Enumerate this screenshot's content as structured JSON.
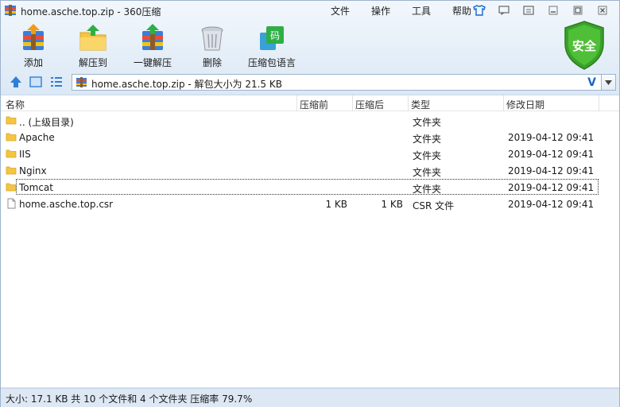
{
  "window": {
    "title": "home.asche.top.zip - 360压缩"
  },
  "menu": [
    "文件",
    "操作",
    "工具",
    "帮助"
  ],
  "toolbar": {
    "add": "添加",
    "extract_to": "解压到",
    "one_click_extract": "一键解压",
    "delete": "删除",
    "comment": "压缩包语言"
  },
  "security": {
    "label": "安全"
  },
  "address": {
    "path": "home.asche.top.zip - 解包大小为 21.5 KB",
    "v_mark": "V"
  },
  "columns": {
    "name": "名称",
    "compressed": "压缩前",
    "packed": "压缩后",
    "type": "类型",
    "modified": "修改日期"
  },
  "files": [
    {
      "name": ".. (上级目录)",
      "before": "",
      "after": "",
      "type": "文件夹",
      "date": "",
      "kind": "folder"
    },
    {
      "name": "Apache",
      "before": "",
      "after": "",
      "type": "文件夹",
      "date": "2019-04-12 09:41",
      "kind": "folder"
    },
    {
      "name": "IIS",
      "before": "",
      "after": "",
      "type": "文件夹",
      "date": "2019-04-12 09:41",
      "kind": "folder"
    },
    {
      "name": "Nginx",
      "before": "",
      "after": "",
      "type": "文件夹",
      "date": "2019-04-12 09:41",
      "kind": "folder"
    },
    {
      "name": "Tomcat",
      "before": "",
      "after": "",
      "type": "文件夹",
      "date": "2019-04-12 09:41",
      "kind": "folder"
    },
    {
      "name": "home.asche.top.csr",
      "before": "1 KB",
      "after": "1 KB",
      "type": "CSR 文件",
      "date": "2019-04-12 09:41",
      "kind": "file"
    }
  ],
  "status": {
    "text": "大小: 17.1 KB 共 10 个文件和 4 个文件夹 压缩率 79.7%"
  },
  "colors": {
    "accent": "#1766c9",
    "folder": "#f5c542",
    "shield": "#3aa12a",
    "selection_outline": "#333333"
  }
}
